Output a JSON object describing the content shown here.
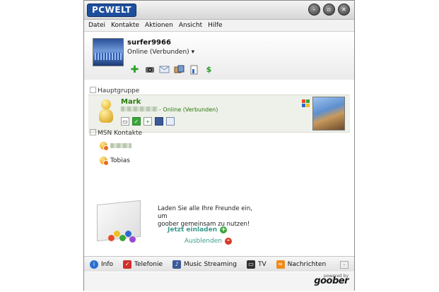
{
  "window": {
    "logo": "PCWELT"
  },
  "window_buttons": [
    "minimize",
    "restore",
    "close"
  ],
  "menu": [
    "Datei",
    "Kontakte",
    "Aktionen",
    "Ansicht",
    "Hilfe"
  ],
  "profile": {
    "username": "surfer9966",
    "status": "Online (Verbunden)",
    "status_caret": "▾"
  },
  "groups": {
    "main": "Hauptgruppe",
    "msn": "MSN Kontakte"
  },
  "selected_contact": {
    "name": "Mark",
    "status": "- Online (Verbunden)"
  },
  "msn_contacts": [
    {
      "name": "Tobias"
    }
  ],
  "invite": {
    "text_line1": "Laden Sie alle Ihre Freunde ein, um",
    "text_line2": "goober gemeinsam zu nutzen!",
    "invite_label": "Jetzt einladen",
    "hide_label": "Ausblenden"
  },
  "tabs": [
    {
      "label": "Info",
      "icon": "info-icon",
      "color": "#2a6fd0"
    },
    {
      "label": "Telefonie",
      "icon": "phone-icon",
      "color": "#d0302a"
    },
    {
      "label": "Music Streaming",
      "icon": "music-icon",
      "color": "#3a5a9a"
    },
    {
      "label": "TV",
      "icon": "tv-icon",
      "color": "#333333"
    },
    {
      "label": "Nachrichten",
      "icon": "rss-icon",
      "color": "#f08a1a"
    }
  ],
  "footer": {
    "powered_by": "powered by",
    "brand": "goober"
  }
}
